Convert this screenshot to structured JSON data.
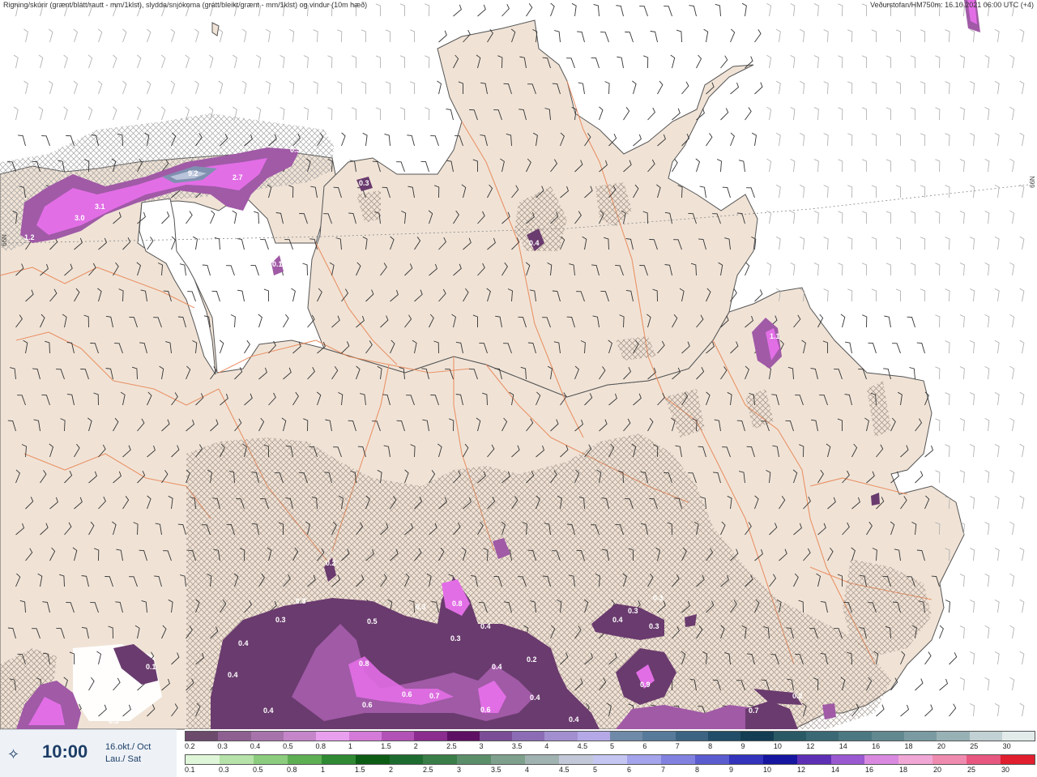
{
  "header": {
    "left_text": "Rigning/skúrir (grænt/blátt/rautt - mm/1klst), slydda/snjókoma (grátt/bleikt/grænt - mm/1klst) og vindur (10m hæð)",
    "right_text": "Veðurstofan/HM750m: 16.10.2021 06:00 UTC (+4)"
  },
  "latitude_labels": {
    "left": "66N",
    "right": "66N"
  },
  "colors": {
    "land": "#f0e3d6",
    "sea": "#ffffff",
    "roads": "#e98a5b",
    "precip_dark": "#6a3b6e",
    "precip_mid": "#a05aa6",
    "precip_bright": "#e26ee6"
  },
  "time_box": {
    "icon": "clock-icon",
    "time": "10:00",
    "date_line1": "16.okt./ Oct",
    "date_line2": "Lau./ Sat"
  },
  "legend_snow": {
    "labels": [
      "0.2",
      "0.3",
      "0.4",
      "0.5",
      "0.8",
      "1",
      "1.5",
      "2",
      "2.5",
      "3",
      "3.5",
      "4",
      "4.5",
      "5",
      "6",
      "7",
      "8",
      "9",
      "10",
      "12",
      "14",
      "16",
      "18",
      "20",
      "25",
      "30"
    ],
    "colors": [
      "#6b4a6c",
      "#8e5f91",
      "#a673aa",
      "#c486c9",
      "#e8a0ee",
      "#d47ad8",
      "#b252b7",
      "#8a2d8f",
      "#5e1162",
      "#7a4d96",
      "#8c6cb4",
      "#a28fd0",
      "#b4a8e6",
      "#6f8aa8",
      "#587a9a",
      "#3c6482",
      "#214d68",
      "#123d52",
      "#2a5966",
      "#3a6874",
      "#4c7882",
      "#628890",
      "#7a9ba1",
      "#97b1b5",
      "#c2d1d3",
      "#e2eaea"
    ]
  },
  "legend_rain": {
    "labels": [
      "0.1",
      "0.3",
      "0.5",
      "0.8",
      "1",
      "1.5",
      "2",
      "2.5",
      "3",
      "3.5",
      "4",
      "4.5",
      "5",
      "6",
      "7",
      "8",
      "9",
      "10",
      "12",
      "14",
      "16",
      "18",
      "20",
      "25",
      "30"
    ],
    "colors": [
      "#dff7d8",
      "#b6e3a9",
      "#8ccc7e",
      "#5eae54",
      "#2f8a33",
      "#0d5c16",
      "#1e6b30",
      "#3a7d48",
      "#5b8f6a",
      "#7ea08c",
      "#a1b3b0",
      "#c3c8d8",
      "#c5c5f2",
      "#a4a4ec",
      "#8181e0",
      "#5b5bd0",
      "#3333bb",
      "#1616a0",
      "#5d2fb5",
      "#9a58d1",
      "#d98ae0",
      "#f1a7d6",
      "#f08bb0",
      "#e8577f",
      "#e01e2e"
    ]
  },
  "precip_labels": [
    {
      "text": "0.3"
    },
    {
      "text": "9.2"
    },
    {
      "text": "2.7"
    },
    {
      "text": "3.1"
    },
    {
      "text": "3.0"
    },
    {
      "text": "1.2"
    },
    {
      "text": "0.3"
    },
    {
      "text": "0.4"
    },
    {
      "text": "0.1"
    },
    {
      "text": "1.1"
    },
    {
      "text": "0.2"
    },
    {
      "text": "0.3"
    },
    {
      "text": "0.3"
    },
    {
      "text": "0.8"
    },
    {
      "text": "0.4"
    },
    {
      "text": "0.5"
    },
    {
      "text": "0.4"
    },
    {
      "text": "0.4"
    },
    {
      "text": "0.3"
    },
    {
      "text": "0.8"
    },
    {
      "text": "0.3"
    },
    {
      "text": "0.4"
    },
    {
      "text": "0.2"
    },
    {
      "text": "0.6"
    },
    {
      "text": "0.7"
    },
    {
      "text": "0.6"
    },
    {
      "text": "0.6"
    },
    {
      "text": "0.4"
    },
    {
      "text": "0.4"
    },
    {
      "text": "0.4"
    },
    {
      "text": "0.3"
    },
    {
      "text": "0.3"
    },
    {
      "text": "0.9"
    },
    {
      "text": "0.3"
    },
    {
      "text": "0.4"
    },
    {
      "text": "0.3"
    },
    {
      "text": "0.1"
    },
    {
      "text": "0.7"
    },
    {
      "text": "0.2"
    }
  ]
}
